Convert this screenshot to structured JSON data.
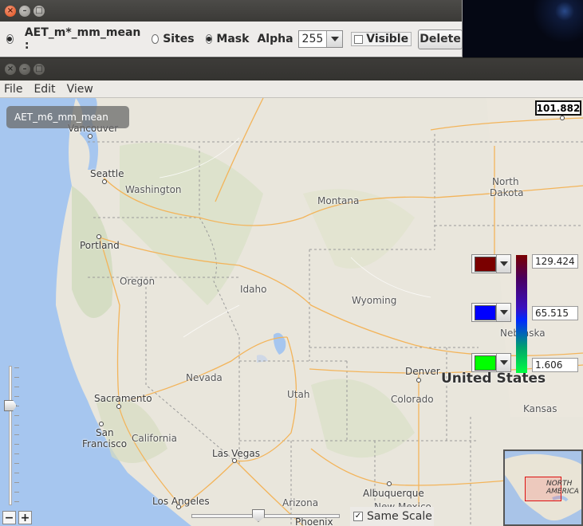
{
  "control_window": {
    "layer_name": "AET_m*_mm_mean :",
    "sites_label": "Sites",
    "mask_label": "Mask",
    "alpha_label": "Alpha",
    "alpha_value": "255",
    "visible_label": "Visible",
    "delete_label": "Delete"
  },
  "main_window": {
    "menu": [
      "File",
      "Edit",
      "View"
    ]
  },
  "map": {
    "layer_label": "AET_m6_mm_mean",
    "probe_value": "101.882",
    "places": {
      "vancouver": "Vancouver",
      "seattle": "Seattle",
      "washington": "Washington",
      "portland": "Portland",
      "oregon": "Oregon",
      "idaho": "Idaho",
      "montana": "Montana",
      "north": "North",
      "dakota": "Dakota",
      "wyoming": "Wyoming",
      "nevada": "Nevada",
      "utah": "Utah",
      "denver": "Denver",
      "colorado": "Colorado",
      "united_states": "United States",
      "kansas": "Kansas",
      "sacramento": "Sacramento",
      "san": "San",
      "francisco": "Francisco",
      "california": "California",
      "las_vegas": "Las Vegas",
      "los_angeles": "Los Angeles",
      "arizona": "Arizona",
      "albuquerque": "Albuquerque",
      "new_mexico": "New Mexico",
      "phoenix": "Phoenix",
      "nebraska": "Nebraska"
    },
    "legend": {
      "max_color": "#7a0000",
      "mid_color": "#0000ff",
      "min_color": "#00ff00",
      "max_value": "129.424",
      "mid_value": "65.515",
      "min_value": "1.606"
    },
    "same_scale_label": "Same Scale",
    "same_scale_checked": true,
    "minimap_label_1": "NORTH",
    "minimap_label_2": "AMERICA"
  }
}
